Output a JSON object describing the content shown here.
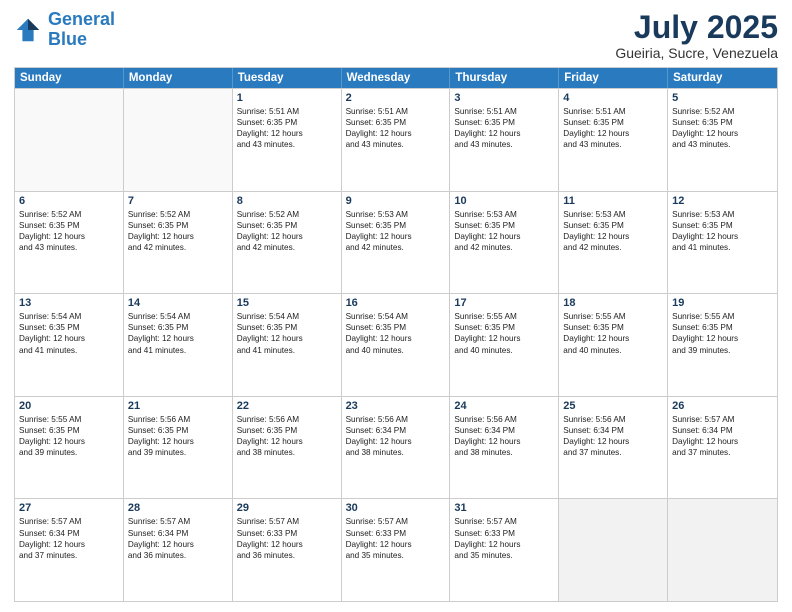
{
  "logo": {
    "line1": "General",
    "line2": "Blue"
  },
  "header": {
    "month": "July 2025",
    "location": "Gueiria, Sucre, Venezuela"
  },
  "weekdays": [
    "Sunday",
    "Monday",
    "Tuesday",
    "Wednesday",
    "Thursday",
    "Friday",
    "Saturday"
  ],
  "weeks": [
    [
      {
        "day": "",
        "sunrise": "",
        "sunset": "",
        "daylight": "",
        "minutes": ""
      },
      {
        "day": "",
        "sunrise": "",
        "sunset": "",
        "daylight": "",
        "minutes": ""
      },
      {
        "day": "1",
        "sunrise": "Sunrise: 5:51 AM",
        "sunset": "Sunset: 6:35 PM",
        "daylight": "Daylight: 12 hours",
        "minutes": "and 43 minutes."
      },
      {
        "day": "2",
        "sunrise": "Sunrise: 5:51 AM",
        "sunset": "Sunset: 6:35 PM",
        "daylight": "Daylight: 12 hours",
        "minutes": "and 43 minutes."
      },
      {
        "day": "3",
        "sunrise": "Sunrise: 5:51 AM",
        "sunset": "Sunset: 6:35 PM",
        "daylight": "Daylight: 12 hours",
        "minutes": "and 43 minutes."
      },
      {
        "day": "4",
        "sunrise": "Sunrise: 5:51 AM",
        "sunset": "Sunset: 6:35 PM",
        "daylight": "Daylight: 12 hours",
        "minutes": "and 43 minutes."
      },
      {
        "day": "5",
        "sunrise": "Sunrise: 5:52 AM",
        "sunset": "Sunset: 6:35 PM",
        "daylight": "Daylight: 12 hours",
        "minutes": "and 43 minutes."
      }
    ],
    [
      {
        "day": "6",
        "sunrise": "Sunrise: 5:52 AM",
        "sunset": "Sunset: 6:35 PM",
        "daylight": "Daylight: 12 hours",
        "minutes": "and 43 minutes."
      },
      {
        "day": "7",
        "sunrise": "Sunrise: 5:52 AM",
        "sunset": "Sunset: 6:35 PM",
        "daylight": "Daylight: 12 hours",
        "minutes": "and 42 minutes."
      },
      {
        "day": "8",
        "sunrise": "Sunrise: 5:52 AM",
        "sunset": "Sunset: 6:35 PM",
        "daylight": "Daylight: 12 hours",
        "minutes": "and 42 minutes."
      },
      {
        "day": "9",
        "sunrise": "Sunrise: 5:53 AM",
        "sunset": "Sunset: 6:35 PM",
        "daylight": "Daylight: 12 hours",
        "minutes": "and 42 minutes."
      },
      {
        "day": "10",
        "sunrise": "Sunrise: 5:53 AM",
        "sunset": "Sunset: 6:35 PM",
        "daylight": "Daylight: 12 hours",
        "minutes": "and 42 minutes."
      },
      {
        "day": "11",
        "sunrise": "Sunrise: 5:53 AM",
        "sunset": "Sunset: 6:35 PM",
        "daylight": "Daylight: 12 hours",
        "minutes": "and 42 minutes."
      },
      {
        "day": "12",
        "sunrise": "Sunrise: 5:53 AM",
        "sunset": "Sunset: 6:35 PM",
        "daylight": "Daylight: 12 hours",
        "minutes": "and 41 minutes."
      }
    ],
    [
      {
        "day": "13",
        "sunrise": "Sunrise: 5:54 AM",
        "sunset": "Sunset: 6:35 PM",
        "daylight": "Daylight: 12 hours",
        "minutes": "and 41 minutes."
      },
      {
        "day": "14",
        "sunrise": "Sunrise: 5:54 AM",
        "sunset": "Sunset: 6:35 PM",
        "daylight": "Daylight: 12 hours",
        "minutes": "and 41 minutes."
      },
      {
        "day": "15",
        "sunrise": "Sunrise: 5:54 AM",
        "sunset": "Sunset: 6:35 PM",
        "daylight": "Daylight: 12 hours",
        "minutes": "and 41 minutes."
      },
      {
        "day": "16",
        "sunrise": "Sunrise: 5:54 AM",
        "sunset": "Sunset: 6:35 PM",
        "daylight": "Daylight: 12 hours",
        "minutes": "and 40 minutes."
      },
      {
        "day": "17",
        "sunrise": "Sunrise: 5:55 AM",
        "sunset": "Sunset: 6:35 PM",
        "daylight": "Daylight: 12 hours",
        "minutes": "and 40 minutes."
      },
      {
        "day": "18",
        "sunrise": "Sunrise: 5:55 AM",
        "sunset": "Sunset: 6:35 PM",
        "daylight": "Daylight: 12 hours",
        "minutes": "and 40 minutes."
      },
      {
        "day": "19",
        "sunrise": "Sunrise: 5:55 AM",
        "sunset": "Sunset: 6:35 PM",
        "daylight": "Daylight: 12 hours",
        "minutes": "and 39 minutes."
      }
    ],
    [
      {
        "day": "20",
        "sunrise": "Sunrise: 5:55 AM",
        "sunset": "Sunset: 6:35 PM",
        "daylight": "Daylight: 12 hours",
        "minutes": "and 39 minutes."
      },
      {
        "day": "21",
        "sunrise": "Sunrise: 5:56 AM",
        "sunset": "Sunset: 6:35 PM",
        "daylight": "Daylight: 12 hours",
        "minutes": "and 39 minutes."
      },
      {
        "day": "22",
        "sunrise": "Sunrise: 5:56 AM",
        "sunset": "Sunset: 6:35 PM",
        "daylight": "Daylight: 12 hours",
        "minutes": "and 38 minutes."
      },
      {
        "day": "23",
        "sunrise": "Sunrise: 5:56 AM",
        "sunset": "Sunset: 6:34 PM",
        "daylight": "Daylight: 12 hours",
        "minutes": "and 38 minutes."
      },
      {
        "day": "24",
        "sunrise": "Sunrise: 5:56 AM",
        "sunset": "Sunset: 6:34 PM",
        "daylight": "Daylight: 12 hours",
        "minutes": "and 38 minutes."
      },
      {
        "day": "25",
        "sunrise": "Sunrise: 5:56 AM",
        "sunset": "Sunset: 6:34 PM",
        "daylight": "Daylight: 12 hours",
        "minutes": "and 37 minutes."
      },
      {
        "day": "26",
        "sunrise": "Sunrise: 5:57 AM",
        "sunset": "Sunset: 6:34 PM",
        "daylight": "Daylight: 12 hours",
        "minutes": "and 37 minutes."
      }
    ],
    [
      {
        "day": "27",
        "sunrise": "Sunrise: 5:57 AM",
        "sunset": "Sunset: 6:34 PM",
        "daylight": "Daylight: 12 hours",
        "minutes": "and 37 minutes."
      },
      {
        "day": "28",
        "sunrise": "Sunrise: 5:57 AM",
        "sunset": "Sunset: 6:34 PM",
        "daylight": "Daylight: 12 hours",
        "minutes": "and 36 minutes."
      },
      {
        "day": "29",
        "sunrise": "Sunrise: 5:57 AM",
        "sunset": "Sunset: 6:33 PM",
        "daylight": "Daylight: 12 hours",
        "minutes": "and 36 minutes."
      },
      {
        "day": "30",
        "sunrise": "Sunrise: 5:57 AM",
        "sunset": "Sunset: 6:33 PM",
        "daylight": "Daylight: 12 hours",
        "minutes": "and 35 minutes."
      },
      {
        "day": "31",
        "sunrise": "Sunrise: 5:57 AM",
        "sunset": "Sunset: 6:33 PM",
        "daylight": "Daylight: 12 hours",
        "minutes": "and 35 minutes."
      },
      {
        "day": "",
        "sunrise": "",
        "sunset": "",
        "daylight": "",
        "minutes": ""
      },
      {
        "day": "",
        "sunrise": "",
        "sunset": "",
        "daylight": "",
        "minutes": ""
      }
    ]
  ]
}
